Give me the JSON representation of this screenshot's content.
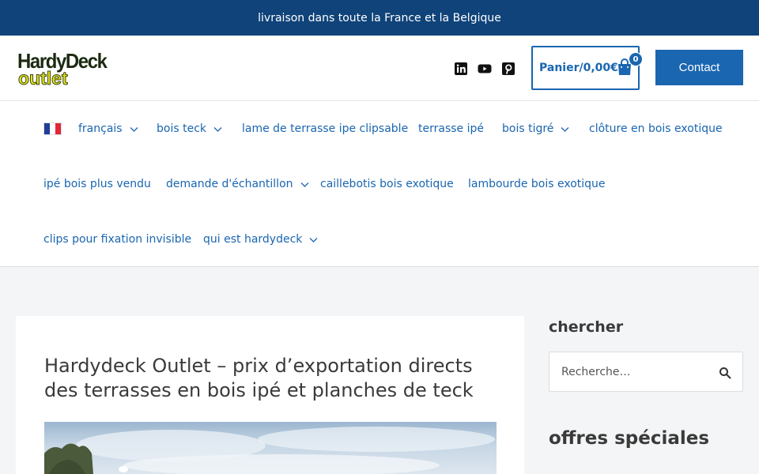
{
  "topbar": {
    "text": "livraison dans toute la France et la Belgique"
  },
  "header": {
    "logo": {
      "line1": "HardyDeck",
      "line2": "outlet"
    },
    "social": [
      "linkedin-icon",
      "youtube-icon",
      "pinterest-icon"
    ],
    "cart": {
      "label": "Panier/0,00€",
      "count": "0"
    },
    "contact_label": "Contact"
  },
  "nav": {
    "items": [
      {
        "label": "français",
        "dropdown": true
      },
      {
        "label": "bois teck",
        "dropdown": true
      },
      {
        "label": "lame de terrasse ipe clipsable",
        "dropdown": false
      },
      {
        "label": "terrasse ipé",
        "dropdown": false
      },
      {
        "label": "bois tigré",
        "dropdown": true
      },
      {
        "label": "clôture en bois exotique",
        "dropdown": false
      },
      {
        "label": "ipé bois plus vendu",
        "dropdown": false
      },
      {
        "label": "demande d'échantillon",
        "dropdown": true
      },
      {
        "label": "caillebotis bois exotique",
        "dropdown": false
      },
      {
        "label": "lambourde bois exotique",
        "dropdown": false
      },
      {
        "label": "clips pour fixation invisible",
        "dropdown": false
      },
      {
        "label": "qui est hardydeck",
        "dropdown": true
      }
    ]
  },
  "main": {
    "title": "Hardydeck Outlet – prix d’exportation directs des terrasses en bois ipé et planches de teck"
  },
  "sidebar": {
    "search_title": "chercher",
    "search_placeholder": "Recherche…",
    "offers_title": "offres spéciales"
  },
  "colors": {
    "brand": "#0f4379",
    "accent": "#1a66b0"
  }
}
